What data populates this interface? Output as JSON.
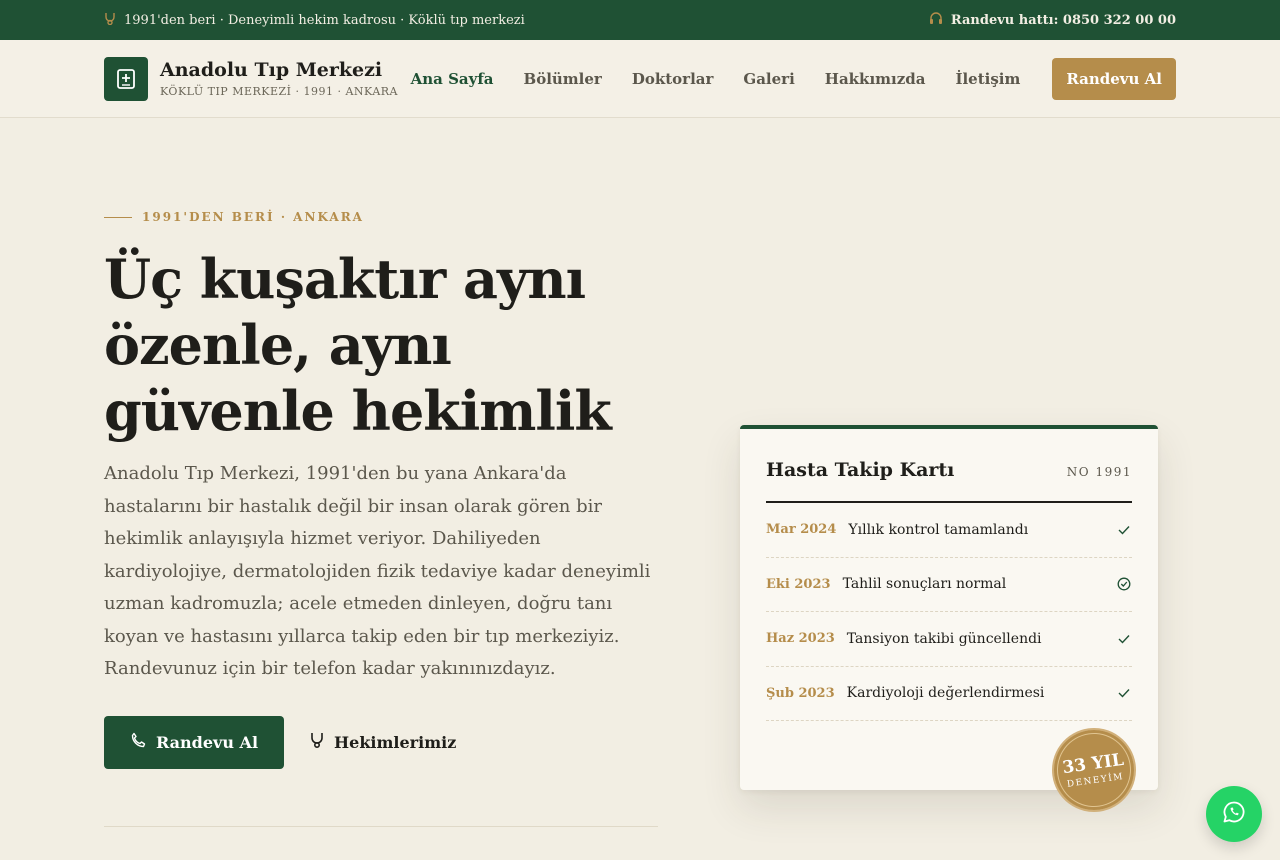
{
  "topbar": {
    "tagline": "1991'den beri · Deneyimli hekim kadrosu · Köklü tıp merkezi",
    "phone_label": "Randevu hattı: 0850 322 00 00"
  },
  "brand": {
    "name": "Anadolu Tıp Merkezi",
    "subtitle": "KÖKLÜ TIP MERKEZİ · 1991 · ANKARA"
  },
  "nav": {
    "items": [
      {
        "label": "Ana Sayfa",
        "active": true
      },
      {
        "label": "Bölümler"
      },
      {
        "label": "Doktorlar"
      },
      {
        "label": "Galeri"
      },
      {
        "label": "Hakkımızda"
      },
      {
        "label": "İletişim"
      }
    ],
    "cta": "Randevu Al"
  },
  "hero": {
    "eyebrow": "1991'DEN BERİ · ANKARA",
    "headline": "Üç kuşaktır aynı özenle, aynı güvenle hekimlik",
    "lead": "Anadolu Tıp Merkezi, 1991'den bu yana Ankara'da hastalarını bir hastalık değil bir insan olarak gören bir hekimlik anlayışıyla hizmet veriyor. Dahiliyeden kardiyolojiye, dermatolojiden fizik tedaviye kadar deneyimli uzman kadromuzla; acele etmeden dinleyen, doğru tanı koyan ve hastasını yıllarca takip eden bir tıp merkeziyiz. Randevunuz için bir telefon kadar yakınınızdayız.",
    "primary_button": "Randevu Al",
    "secondary_button": "Hekimlerimiz"
  },
  "card": {
    "title": "Hasta Takip Kartı",
    "number": "NO 1991",
    "rows": [
      {
        "date": "Mar 2024",
        "text": "Yıllık kontrol tamamlandı",
        "icon": "check-icon"
      },
      {
        "date": "Eki 2023",
        "text": "Tahlil sonuçları normal",
        "icon": "check-circle-icon"
      },
      {
        "date": "Haz 2023",
        "text": "Tansiyon takibi güncellendi",
        "icon": "check-icon"
      },
      {
        "date": "Şub 2023",
        "text": "Kardiyoloji değerlendirmesi",
        "icon": "check-icon"
      }
    ]
  },
  "seal": {
    "big": "33 YIL",
    "small": "DENEYİM"
  },
  "colors": {
    "primary": "#1f5134",
    "accent": "#b58d4b",
    "background": "#f2eee3",
    "whatsapp": "#25d366"
  }
}
